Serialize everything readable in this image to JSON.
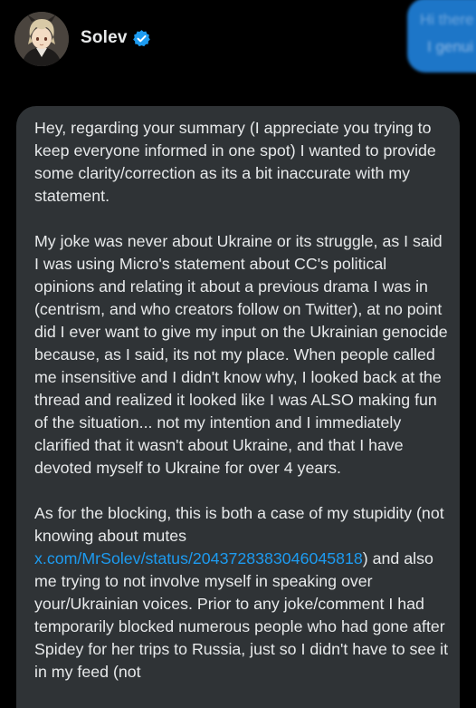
{
  "sender": {
    "name": "Solev",
    "avatar_icon": "avatar-anime-character",
    "verified_icon": "verified-badge-icon",
    "verified_color": "#1d9bf0"
  },
  "other_message": {
    "line1": "Hi there",
    "line2": "I genui"
  },
  "message": {
    "p1": "Hey, regarding your summary (I appreciate you trying to keep everyone informed in one spot) I wanted to provide some clarity/correction as its a bit inaccurate with my statement.",
    "p2": "My joke was never about Ukraine or its struggle, as I said I was using Micro's statement about CC's political opinions and relating it about a previous drama I was in (centrism, and who creators follow on Twitter), at no point did I ever want to give my input on the Ukrainian genocide because, as I said, its not my place. When people called me insensitive and I didn't know why, I looked back at the thread and realized it looked like I was ALSO making fun of the situation... not my intention and I immediately clarified that it wasn't about Ukraine, and that I have devoted myself to Ukraine for over 4 years.",
    "p3_before": "As for the blocking, this is both a case of my stupidity (not knowing about mutes ",
    "p3_link": "x.com/MrSolev/status/2043728383046045818",
    "p3_after": ") and also me trying to not involve myself in speaking over your/Ukrainian voices. Prior to any joke/comment I had temporarily blocked numerous people who had gone after Spidey for her trips to Russia, just so I didn't have to see it in my feed (not"
  },
  "colors": {
    "background": "#000000",
    "bubble": "#2f3336",
    "text": "#e7e9ea",
    "link": "#1d9bf0",
    "other_bubble": "#1d76c8"
  }
}
